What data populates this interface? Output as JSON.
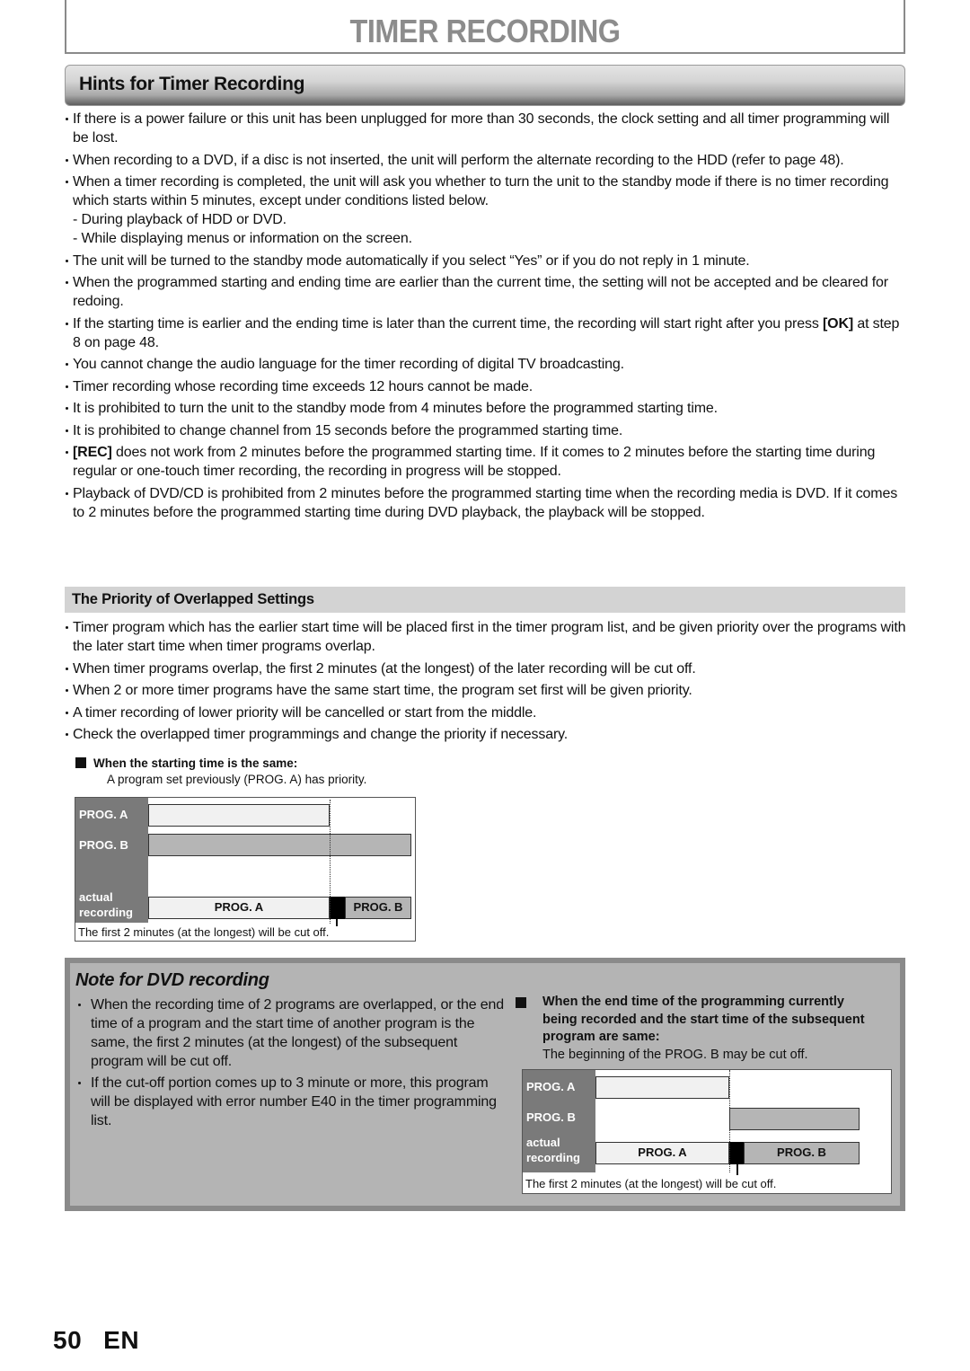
{
  "page_title": "TIMER RECORDING",
  "section": {
    "title": "Hints for Timer Recording",
    "bullets": [
      {
        "text": "If there is a power failure or this unit has been unplugged for more than 30 seconds, the clock setting and all timer programming will be lost."
      },
      {
        "text": "When recording to a DVD, if a disc is not inserted, the unit will perform the alternate recording to the HDD (refer to page 48)."
      },
      {
        "text": "When a timer recording is completed, the unit will ask you whether to turn the unit to the standby mode if there is no timer recording which starts within 5 minutes, except under conditions listed below.",
        "subitems": [
          "- During playback of HDD or DVD.",
          "- While displaying menus or information on the screen."
        ]
      },
      {
        "text": "The unit will be turned to the standby mode automatically if you select “Yes” or if you do not reply in 1 minute."
      },
      {
        "text": "When the programmed starting and ending time are earlier than the current time, the setting will not be accepted and be cleared for redoing."
      },
      {
        "pre": "If the starting time is earlier and the ending time is later than the current time, the recording will start right after you press ",
        "key": "[OK]",
        "post": " at step 8 on page 48."
      },
      {
        "text": "You cannot change the audio language for the timer recording of digital TV broadcasting."
      },
      {
        "text": "Timer recording whose recording time exceeds 12 hours cannot be made."
      },
      {
        "text": "It is prohibited to turn the unit to the standby mode from 4 minutes before the programmed starting time."
      },
      {
        "text": "It is prohibited to change channel from 15 seconds before the programmed starting time."
      },
      {
        "key": "[REC]",
        "post": " does not work from 2 minutes before the programmed starting time. If it comes to 2 minutes before the starting time during regular or one-touch timer recording, the recording in progress will be stopped."
      },
      {
        "text": "Playback of DVD/CD is prohibited from 2 minutes before the programmed starting time when the recording media is DVD. If it comes to 2 minutes before the programmed starting time during DVD playback, the playback will be stopped."
      }
    ]
  },
  "priority": {
    "title": "The Priority of Overlapped Settings",
    "bullets": [
      "Timer program which has the earlier start time will be placed first in the timer program list, and be given priority over the programs with the later start time when timer programs overlap.",
      "When timer programs overlap, the first 2 minutes (at the longest) of the later recording will be cut off.",
      "When 2 or more timer programs have the same start time, the program set first will be given priority.",
      "A timer recording of lower priority will be cancelled or start from the middle.",
      "Check the overlapped timer programmings and change the priority if necessary."
    ],
    "diagram1": {
      "heading": "When the starting time is the same:",
      "description": "A program set previously (PROG. A) has priority.",
      "row_labels": [
        "PROG. A",
        "PROG. B",
        "actual",
        "recording"
      ],
      "bar_labels": [
        "PROG. A",
        "PROG. B"
      ],
      "caption": "The first 2 minutes (at the longest) will be cut off."
    }
  },
  "note": {
    "title": "Note for DVD recording",
    "bullets": [
      "When the recording time of 2 programs are overlapped, or the end time of a program and the start time of another program is the same, the first 2 minutes (at the longest) of the subsequent program will be cut off.",
      "If the cut-off portion comes up to 3 minute or more, this program will be displayed with error number E40 in the timer programming list."
    ],
    "diagram2": {
      "heading": "When the end time of the programming currently being recorded and the start time of the subsequent program are same:",
      "description": "The beginning of the PROG. B may be cut off.",
      "row_labels": [
        "PROG. A",
        "PROG. B",
        "actual",
        "recording"
      ],
      "bar_labels": [
        "PROG. A",
        "PROG. B"
      ],
      "caption": "The first 2 minutes (at the longest) will be cut off."
    }
  },
  "footer": {
    "page_number": "50",
    "language": "EN"
  }
}
